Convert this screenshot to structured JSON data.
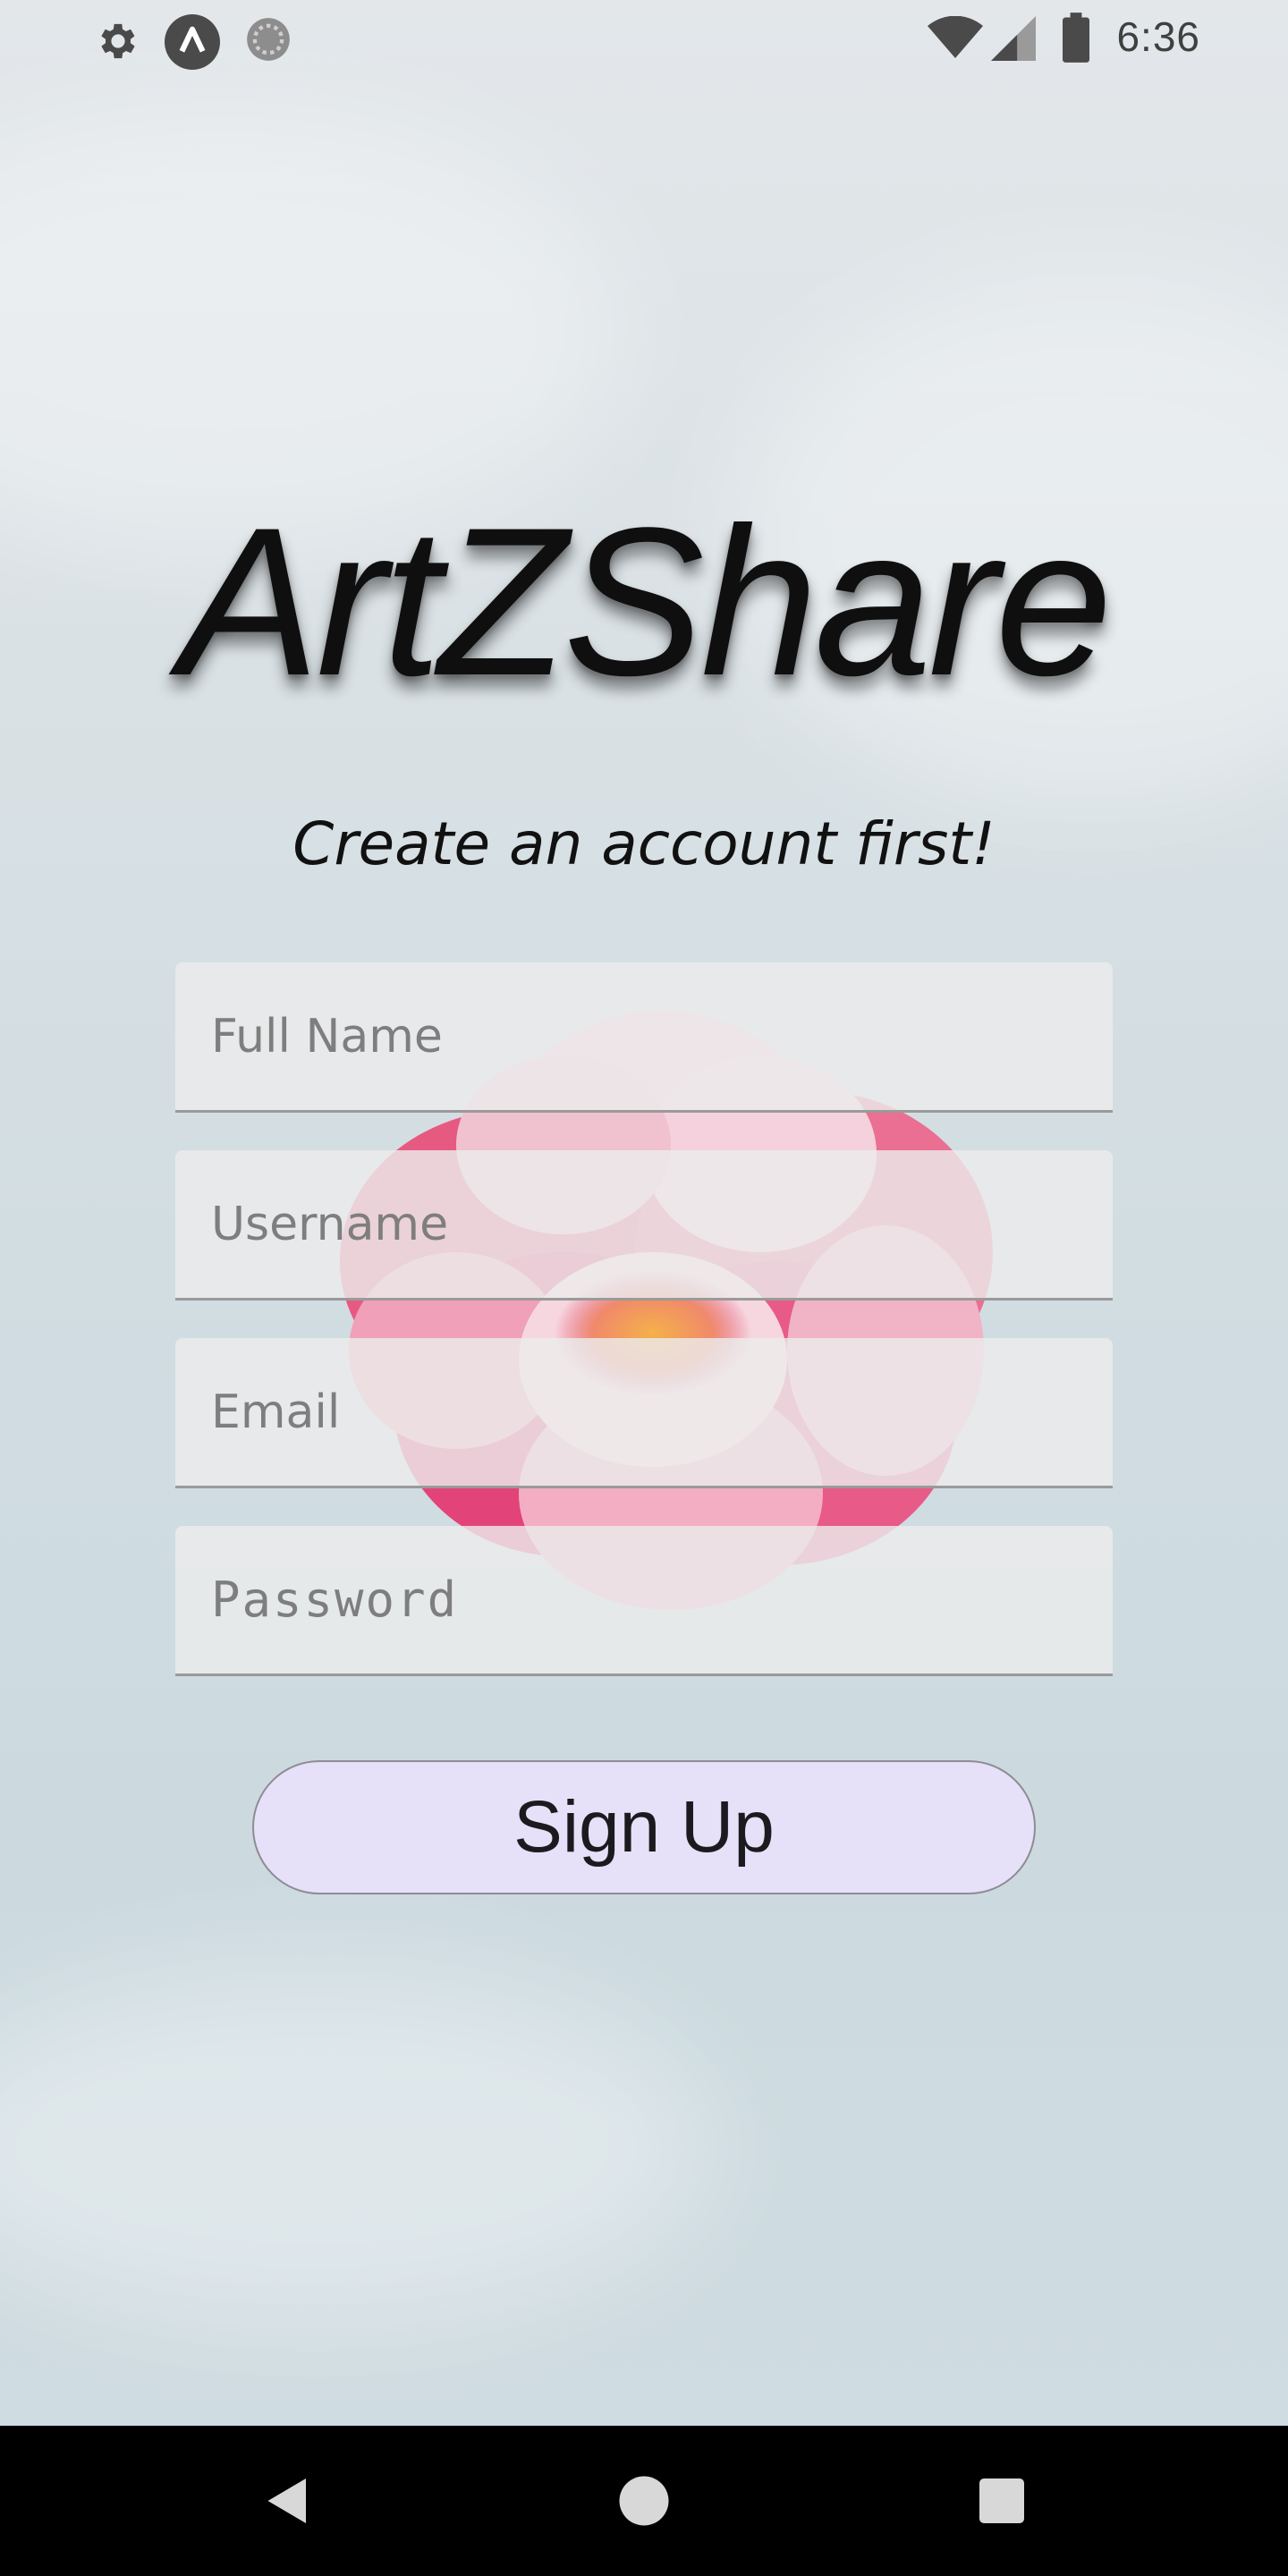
{
  "status_bar": {
    "time": "6:36",
    "left_icons": [
      "settings-gear-icon",
      "app-a-icon",
      "loading-circle-icon"
    ],
    "right_icons": [
      "wifi-icon",
      "cell-signal-icon",
      "battery-icon"
    ]
  },
  "app": {
    "title": "ArtZShare",
    "subtitle": "Create an account first!"
  },
  "form": {
    "full_name": {
      "placeholder": "Full Name",
      "value": ""
    },
    "username": {
      "placeholder": "Username",
      "value": ""
    },
    "email": {
      "placeholder": "Email",
      "value": ""
    },
    "password": {
      "placeholder": "Password",
      "value": ""
    }
  },
  "signup_button": {
    "label": "Sign Up"
  },
  "colors": {
    "button_bg": "#e6e0f8",
    "field_bg": "#ececec",
    "nav_bar": "#000000"
  },
  "nav_bar": {
    "icons": [
      "back-triangle-icon",
      "home-circle-icon",
      "recents-square-icon"
    ]
  }
}
